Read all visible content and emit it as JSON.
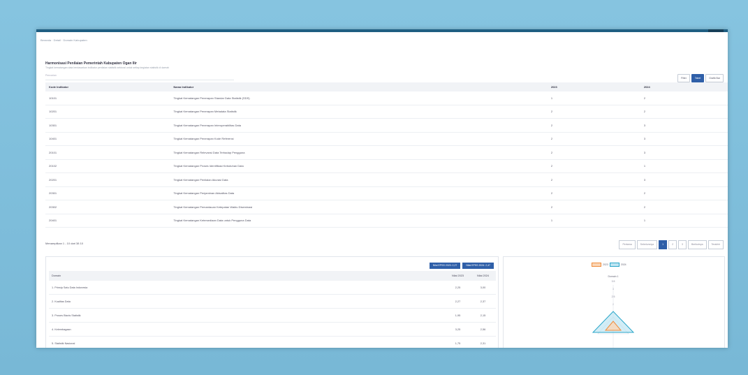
{
  "breadcrumb": "Beranda · Detail · Domain Kabupaten",
  "page": {
    "title": "Harmonisasi Penilaian Pemerintah Kabupaten Ogan Ilir",
    "subtitle": "Tingkat kematangan data berdasarkan indikator penilaian statistik sektoral untuk setiap kegiatan statistik di daerah",
    "search_placeholder": "Pencarian"
  },
  "view_buttons": [
    "Filter",
    "Tabel",
    "Grafik Bar"
  ],
  "table": {
    "headers": [
      "Kode Indikator",
      "Nama Indikator",
      "2023",
      "2024"
    ],
    "rows": [
      [
        "10101",
        "Tingkat Kematangan Penerapan Standar Data Statistik (SDS)",
        "1",
        "2"
      ],
      [
        "10201",
        "Tingkat Kematangan Penerapan Metadata Statistik",
        "2",
        "2"
      ],
      [
        "10301",
        "Tingkat Kematangan Penerapan Interoperabilitas Data",
        "2",
        "3"
      ],
      [
        "10401",
        "Tingkat Kematangan Penerapan Kode Referensi",
        "2",
        "3"
      ],
      [
        "20101",
        "Tingkat Kematangan Relevansi Data Terhadap Pengguna",
        "2",
        "3"
      ],
      [
        "20102",
        "Tingkat Kematangan Proses Identifikasi Kebutuhan Data",
        "2",
        "1"
      ],
      [
        "20201",
        "Tingkat Kematangan Penilaian Akurasi Data",
        "2",
        "3"
      ],
      [
        "20301",
        "Tingkat Kematangan Penjaminan Aktualitas Data",
        "2",
        "2"
      ],
      [
        "20302",
        "Tingkat Kematangan Pemantauan Ketepatan Waktu Diseminasi",
        "2",
        "2"
      ],
      [
        "20401",
        "Tingkat Kematangan Ketersediaan Data untuk Pengguna Data",
        "1",
        "1"
      ]
    ]
  },
  "rows_info": "Menampilkan 1 - 10 dari 38   10",
  "pager": [
    "Pertama",
    "Sebelumnya",
    "1",
    "2",
    "3",
    "Berikutnya",
    "Terakhir"
  ],
  "sub": {
    "buttons": [
      "Nilai EPSS 2023: 2,27",
      "Nilai EPSS 2024: 2,47"
    ],
    "headers": [
      "Domain",
      "Nilai 2023",
      "Nilai 2024"
    ],
    "rows": [
      [
        "1. Prinsip Satu Data Indonesia",
        "2,25",
        "3,00"
      ],
      [
        "2. Kualitas Data",
        "2,27",
        "2,37"
      ],
      [
        "3. Proses Bisnis Statistik",
        "1,95",
        "2,15"
      ],
      [
        "4. Kelembagaan",
        "3,25",
        "2,56"
      ],
      [
        "5. Statistik Nasional",
        "1,75",
        "2,31"
      ]
    ]
  },
  "radar": {
    "legend": [
      "2023",
      "2024"
    ],
    "axis_label": "Domain 1",
    "ticks": [
      "3.5",
      "3",
      "2.5",
      "2"
    ],
    "colors": {
      "s2023": "#f08c3c",
      "s2024": "#2aa6c9"
    }
  }
}
